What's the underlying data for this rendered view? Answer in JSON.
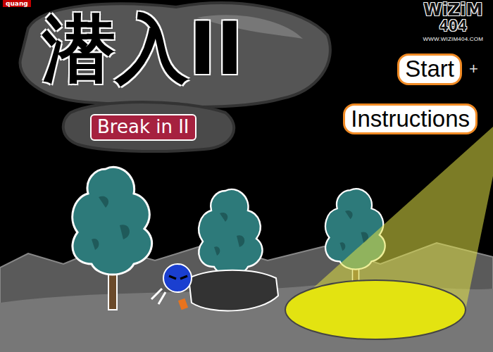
{
  "ad_badge": {
    "text": "quang"
  },
  "logo": {
    "name": "WiZiM",
    "number": "404",
    "url": "WWW.WIZIM404.COM"
  },
  "title": "潜入II",
  "subtitle": "Break in II",
  "menu": [
    {
      "label": "Start"
    },
    {
      "label": "Instructions"
    }
  ],
  "cursor": "+"
}
